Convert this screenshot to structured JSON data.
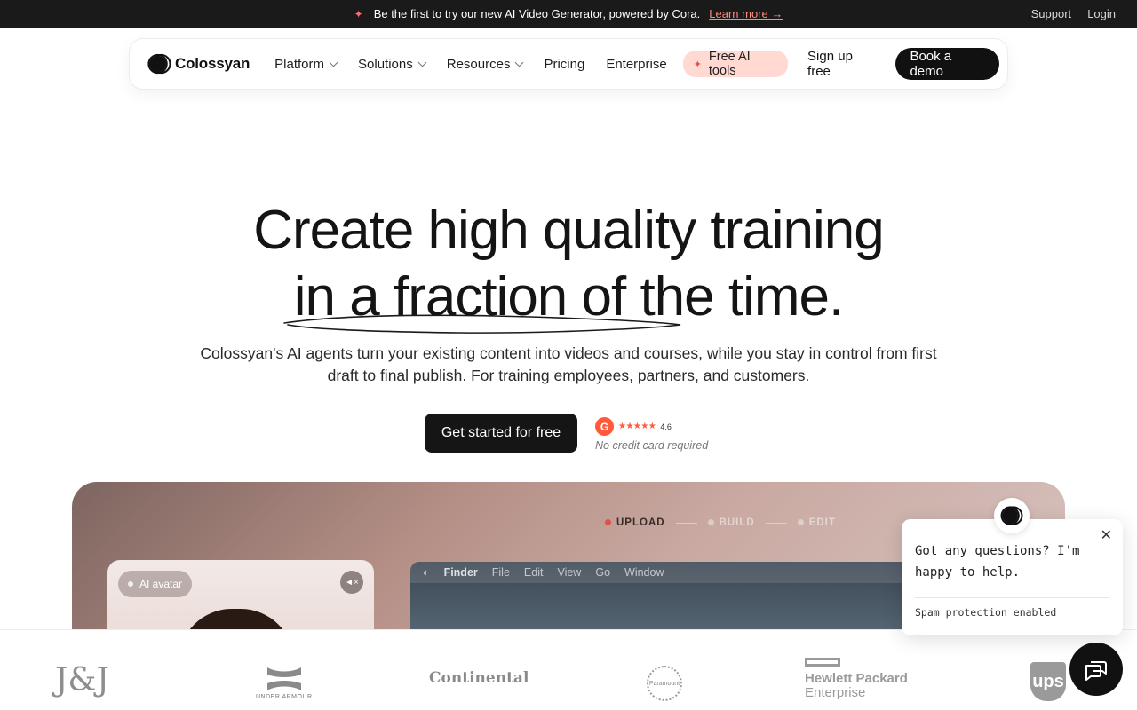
{
  "announcement": {
    "text": "Be the first to try our new AI Video Generator, powered by Cora.",
    "link": "Learn more →",
    "support": "Support",
    "login": "Login"
  },
  "nav": {
    "brand": "Colossyan",
    "platform": "Platform",
    "solutions": "Solutions",
    "resources": "Resources",
    "pricing": "Pricing",
    "enterprise": "Enterprise",
    "free_tools": "Free AI tools",
    "signup": "Sign up free",
    "book_demo": "Book a demo"
  },
  "hero": {
    "title_line1": "Create high quality training",
    "title_line2": "in a fraction of the time.",
    "subtitle": "Colossyan's AI agents turn your existing content into videos and courses, while you stay in control from first draft to final publish. For training employees, partners, and customers.",
    "cta": "Get started for free",
    "rating_badge": "G",
    "rating_stars": "★★★★★",
    "rating_score": "4.6",
    "no_card": "No credit card required"
  },
  "preview": {
    "steps": [
      "UPLOAD",
      "BUILD",
      "EDIT"
    ],
    "avatar_badge": "AI avatar",
    "finder_menu": [
      "Finder",
      "File",
      "Edit",
      "View",
      "Go",
      "Window"
    ]
  },
  "logos": {
    "jj": "J&J",
    "under_armour": "UNDER ARMOUR",
    "continental": "Continental",
    "paramount": "Paramount",
    "hpe_line1": "Hewlett Packard",
    "hpe_line2": "Enterprise",
    "ups": "ups"
  },
  "chat": {
    "message": "Got any questions? I'm happy to help.",
    "spam": "Spam protection enabled"
  },
  "colors": {
    "accent": "#ff5a3c",
    "dark": "#111111",
    "free_tools_bg": "#ffd9d2"
  }
}
